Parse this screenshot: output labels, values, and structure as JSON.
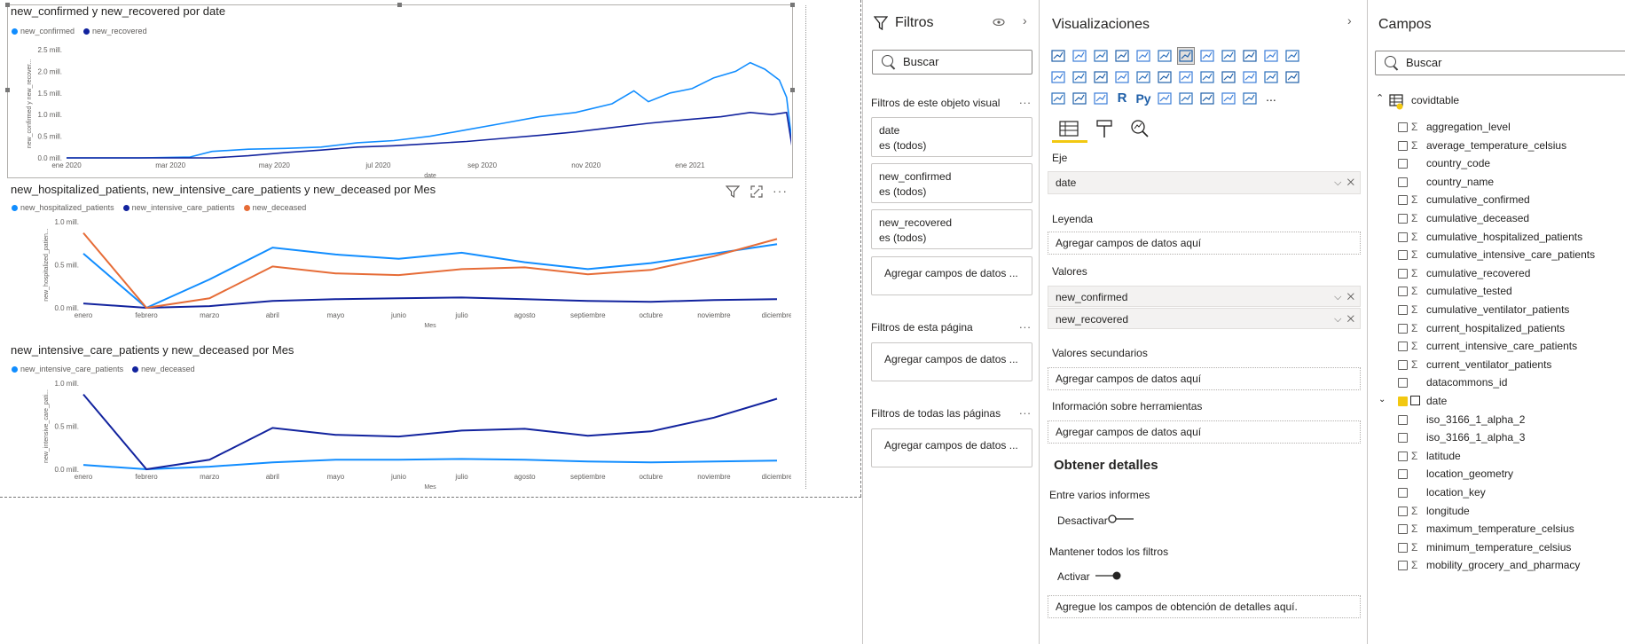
{
  "chart1": {
    "title": "new_confirmed y new_recovered por date",
    "legend": [
      {
        "name": "new_confirmed",
        "color": "#118dff"
      },
      {
        "name": "new_recovered",
        "color": "#12239e"
      }
    ],
    "yticks": [
      "2.5 mill.",
      "2.0 mill.",
      "1.5 mill.",
      "1.0 mill.",
      "0.5 mill.",
      "0.0 mill."
    ],
    "xticks": [
      "ene 2020",
      "mar 2020",
      "may 2020",
      "jul 2020",
      "sep 2020",
      "nov 2020",
      "ene 2021"
    ],
    "ylabel": "new_confirmed y new_recover...",
    "xlabel": "date"
  },
  "chart2": {
    "title": "new_hospitalized_patients, new_intensive_care_patients y new_deceased por Mes",
    "legend": [
      {
        "name": "new_hospitalized_patients",
        "color": "#118dff"
      },
      {
        "name": "new_intensive_care_patients",
        "color": "#12239e"
      },
      {
        "name": "new_deceased",
        "color": "#e66c37"
      }
    ],
    "yticks": [
      "1.0 mill.",
      "0.5 mill.",
      "0.0 mill."
    ],
    "xticks": [
      "enero",
      "febrero",
      "marzo",
      "abril",
      "mayo",
      "junio",
      "julio",
      "agosto",
      "septiembre",
      "octubre",
      "noviembre",
      "diciembre"
    ],
    "ylabel": "new_hospitalized_patien...",
    "xlabel": "Mes"
  },
  "chart3": {
    "title": "new_intensive_care_patients y new_deceased por Mes",
    "legend": [
      {
        "name": "new_intensive_care_patients",
        "color": "#118dff"
      },
      {
        "name": "new_deceased",
        "color": "#12239e"
      }
    ],
    "yticks": [
      "1.0 mill.",
      "0.5 mill.",
      "0.0 mill."
    ],
    "xticks": [
      "enero",
      "febrero",
      "marzo",
      "abril",
      "mayo",
      "junio",
      "julio",
      "agosto",
      "septiembre",
      "octubre",
      "noviembre",
      "diciembre"
    ],
    "ylabel": "new_intensive_care_pati...",
    "xlabel": "Mes"
  },
  "chart_data": [
    {
      "type": "line",
      "title": "new_confirmed y new_recovered por date",
      "x_range": [
        "2020-01-01",
        "2021-02-28"
      ],
      "ylim": [
        0,
        2.5
      ],
      "ylabel": "new_confirmed y new_recover...",
      "xlabel": "date",
      "series": [
        {
          "name": "new_confirmed",
          "values": [
            [
              0,
              0
            ],
            [
              0.1,
              0
            ],
            [
              0.17,
              0.02
            ],
            [
              0.2,
              0.15
            ],
            [
              0.25,
              0.2
            ],
            [
              0.3,
              0.22
            ],
            [
              0.35,
              0.25
            ],
            [
              0.4,
              0.35
            ],
            [
              0.45,
              0.4
            ],
            [
              0.5,
              0.5
            ],
            [
              0.55,
              0.65
            ],
            [
              0.6,
              0.8
            ],
            [
              0.65,
              0.95
            ],
            [
              0.7,
              1.05
            ],
            [
              0.75,
              1.25
            ],
            [
              0.78,
              1.55
            ],
            [
              0.8,
              1.3
            ],
            [
              0.83,
              1.5
            ],
            [
              0.86,
              1.6
            ],
            [
              0.89,
              1.85
            ],
            [
              0.92,
              2.0
            ],
            [
              0.94,
              2.2
            ],
            [
              0.96,
              2.05
            ],
            [
              0.98,
              1.8
            ],
            [
              0.99,
              1.4
            ],
            [
              1.0,
              0
            ]
          ]
        },
        {
          "name": "new_recovered",
          "values": [
            [
              0,
              0
            ],
            [
              0.1,
              0
            ],
            [
              0.2,
              0
            ],
            [
              0.25,
              0.05
            ],
            [
              0.3,
              0.12
            ],
            [
              0.35,
              0.18
            ],
            [
              0.4,
              0.25
            ],
            [
              0.45,
              0.28
            ],
            [
              0.5,
              0.33
            ],
            [
              0.55,
              0.38
            ],
            [
              0.6,
              0.45
            ],
            [
              0.65,
              0.52
            ],
            [
              0.7,
              0.6
            ],
            [
              0.75,
              0.7
            ],
            [
              0.8,
              0.8
            ],
            [
              0.85,
              0.88
            ],
            [
              0.9,
              0.95
            ],
            [
              0.94,
              1.05
            ],
            [
              0.97,
              1.0
            ],
            [
              0.99,
              1.05
            ],
            [
              1.0,
              0
            ]
          ]
        }
      ]
    },
    {
      "type": "line",
      "title": "new_hospitalized_patients, new_intensive_care_patients y new_deceased por Mes",
      "categories": [
        "enero",
        "febrero",
        "marzo",
        "abril",
        "mayo",
        "junio",
        "julio",
        "agosto",
        "septiembre",
        "octubre",
        "noviembre",
        "diciembre"
      ],
      "ylim": [
        0,
        1.0
      ],
      "series": [
        {
          "name": "new_hospitalized_patients",
          "values": [
            0.63,
            0.0,
            0.33,
            0.7,
            0.62,
            0.57,
            0.64,
            0.53,
            0.45,
            0.52,
            0.63,
            0.74
          ]
        },
        {
          "name": "new_intensive_care_patients",
          "values": [
            0.05,
            0.0,
            0.02,
            0.08,
            0.1,
            0.11,
            0.12,
            0.1,
            0.08,
            0.07,
            0.09,
            0.1
          ]
        },
        {
          "name": "new_deceased",
          "values": [
            0.87,
            0.0,
            0.11,
            0.48,
            0.4,
            0.38,
            0.45,
            0.47,
            0.39,
            0.44,
            0.6,
            0.8
          ]
        }
      ]
    },
    {
      "type": "line",
      "title": "new_intensive_care_patients y new_deceased por Mes",
      "categories": [
        "enero",
        "febrero",
        "marzo",
        "abril",
        "mayo",
        "junio",
        "julio",
        "agosto",
        "septiembre",
        "octubre",
        "noviembre",
        "diciembre"
      ],
      "ylim": [
        0,
        1.0
      ],
      "series": [
        {
          "name": "new_intensive_care_patients",
          "values": [
            0.05,
            0.0,
            0.03,
            0.08,
            0.11,
            0.11,
            0.12,
            0.11,
            0.09,
            0.08,
            0.09,
            0.1
          ]
        },
        {
          "name": "new_deceased",
          "values": [
            0.87,
            0.0,
            0.11,
            0.48,
            0.4,
            0.38,
            0.45,
            0.47,
            0.39,
            0.44,
            0.6,
            0.82
          ]
        }
      ]
    }
  ],
  "filters": {
    "title": "Filtros",
    "search": "Buscar",
    "visual_section": "Filtros de este objeto visual",
    "visual_cards": [
      {
        "field": "date",
        "state": "es (todos)"
      },
      {
        "field": "new_confirmed",
        "state": "es (todos)"
      },
      {
        "field": "new_recovered",
        "state": "es (todos)"
      }
    ],
    "add_label": "Agregar campos de datos ...",
    "page_section": "Filtros de esta página",
    "all_section": "Filtros de todas las páginas",
    "more": "..."
  },
  "viz": {
    "title": "Visualizaciones",
    "eje": "Eje",
    "eje_value": "date",
    "leyenda": "Leyenda",
    "leyenda_placeholder": "Agregar campos de datos aquí",
    "valores": "Valores",
    "valores_items": [
      "new_confirmed",
      "new_recovered"
    ],
    "secundarios": "Valores secundarios",
    "secundarios_placeholder": "Agregar campos de datos aquí",
    "tooltips": "Información sobre herramientas",
    "tooltips_placeholder": "Agregar campos de datos aquí",
    "drill_title": "Obtener detalles",
    "cross_report": "Entre varios informes",
    "cross_report_state": "Desactivar",
    "keep_filters": "Mantener todos los filtros",
    "keep_filters_state": "Activar",
    "drill_placeholder": "Agregue los campos de obtención de detalles aquí.",
    "icon_r": "R",
    "icon_py": "Py",
    "more": "..."
  },
  "fields": {
    "title": "Campos",
    "search": "Buscar",
    "table": "covidtable",
    "items": [
      {
        "name": "aggregation_level",
        "sigma": true,
        "checked": false,
        "calendar": false
      },
      {
        "name": "average_temperature_celsius",
        "sigma": true,
        "checked": false,
        "calendar": false
      },
      {
        "name": "country_code",
        "sigma": false,
        "checked": false,
        "calendar": false
      },
      {
        "name": "country_name",
        "sigma": false,
        "checked": false,
        "calendar": false
      },
      {
        "name": "cumulative_confirmed",
        "sigma": true,
        "checked": false,
        "calendar": false
      },
      {
        "name": "cumulative_deceased",
        "sigma": true,
        "checked": false,
        "calendar": false
      },
      {
        "name": "cumulative_hospitalized_patients",
        "sigma": true,
        "checked": false,
        "calendar": false
      },
      {
        "name": "cumulative_intensive_care_patients",
        "sigma": true,
        "checked": false,
        "calendar": false
      },
      {
        "name": "cumulative_recovered",
        "sigma": true,
        "checked": false,
        "calendar": false
      },
      {
        "name": "cumulative_tested",
        "sigma": true,
        "checked": false,
        "calendar": false
      },
      {
        "name": "cumulative_ventilator_patients",
        "sigma": true,
        "checked": false,
        "calendar": false
      },
      {
        "name": "current_hospitalized_patients",
        "sigma": true,
        "checked": false,
        "calendar": false
      },
      {
        "name": "current_intensive_care_patients",
        "sigma": true,
        "checked": false,
        "calendar": false
      },
      {
        "name": "current_ventilator_patients",
        "sigma": true,
        "checked": false,
        "calendar": false
      },
      {
        "name": "datacommons_id",
        "sigma": false,
        "checked": false,
        "calendar": false
      },
      {
        "name": "date",
        "sigma": false,
        "checked": true,
        "calendar": true
      },
      {
        "name": "iso_3166_1_alpha_2",
        "sigma": false,
        "checked": false,
        "calendar": false
      },
      {
        "name": "iso_3166_1_alpha_3",
        "sigma": false,
        "checked": false,
        "calendar": false
      },
      {
        "name": "latitude",
        "sigma": true,
        "checked": false,
        "calendar": false
      },
      {
        "name": "location_geometry",
        "sigma": false,
        "checked": false,
        "calendar": false
      },
      {
        "name": "location_key",
        "sigma": false,
        "checked": false,
        "calendar": false
      },
      {
        "name": "longitude",
        "sigma": true,
        "checked": false,
        "calendar": false
      },
      {
        "name": "maximum_temperature_celsius",
        "sigma": true,
        "checked": false,
        "calendar": false
      },
      {
        "name": "minimum_temperature_celsius",
        "sigma": true,
        "checked": false,
        "calendar": false
      },
      {
        "name": "mobility_grocery_and_pharmacy",
        "sigma": true,
        "checked": false,
        "calendar": false
      }
    ]
  }
}
